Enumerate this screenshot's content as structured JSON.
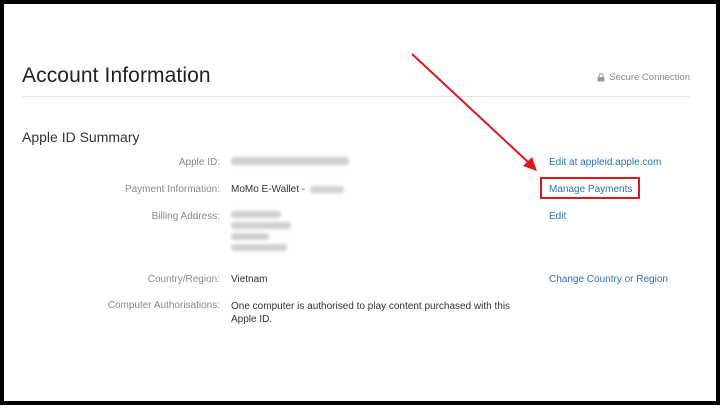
{
  "header": {
    "title": "Account Information",
    "secure_label": "Secure Connection",
    "secure_icon": "lock-icon"
  },
  "summary": {
    "title": "Apple ID Summary",
    "rows": [
      {
        "label": "Apple ID:",
        "value": "",
        "action": "Edit at appleid.apple.com"
      },
      {
        "label": "Payment Information:",
        "value": "MoMo E-Wallet -",
        "action": "Manage Payments"
      },
      {
        "label": "Billing Address:",
        "value": "",
        "action": "Edit"
      },
      {
        "label": "Country/Region:",
        "value": "Vietnam",
        "action": "Change Country or Region"
      },
      {
        "label": "Computer Authorisations:",
        "value": "One computer is authorised to play content purchased with this Apple ID.",
        "action": ""
      }
    ]
  },
  "annotation": {
    "arrow_color": "#e0161f",
    "box_color": "#e0161f"
  },
  "colors": {
    "link": "#2f6fb7",
    "label": "#888888",
    "text": "#333333"
  }
}
